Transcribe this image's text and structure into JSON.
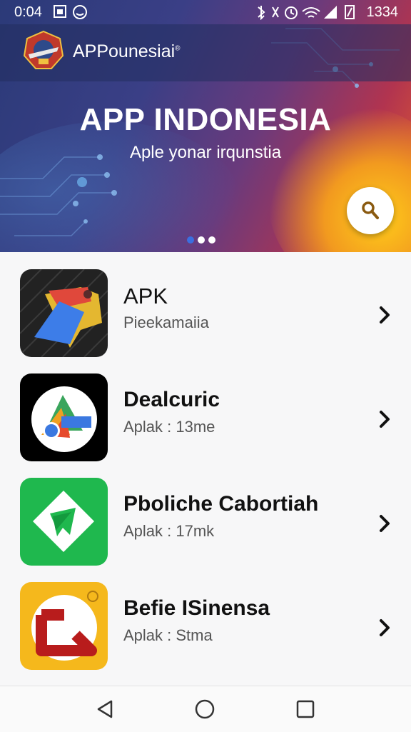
{
  "status_bar": {
    "time": "0:04",
    "battery": "1334",
    "left_icons": [
      "gallery-icon",
      "face-icon"
    ],
    "right_icons": [
      "bluetooth-icon",
      "vibrate-icon",
      "alarm-icon",
      "wifi-icon",
      "signal-icon",
      "battery-icon"
    ]
  },
  "app_bar": {
    "app_name": "APPounesiai",
    "trademark": "®"
  },
  "hero": {
    "title": "APP INDONESIA",
    "subtitle": "Aple yonar irqunstia",
    "slides": 3,
    "active_slide": 1
  },
  "apps": [
    {
      "name": "APK",
      "subtitle": "Pieekamaiia",
      "icon": "colored-tag-icon"
    },
    {
      "name": "Dealcuric",
      "subtitle": "Aplak : 13me",
      "icon": "google-shape-icon"
    },
    {
      "name": "Pboliche Cabortiah",
      "subtitle": "Aplak : 17mk",
      "icon": "green-diamond-icon"
    },
    {
      "name": "Befie ISinensa",
      "subtitle": "Aplak : Stma",
      "icon": "red-arrow-icon"
    }
  ],
  "colors": {
    "accent_blue": "#3b6fe0",
    "header_start": "#2b3a78",
    "header_end": "#e5602b",
    "search_icon": "#8a5a10"
  }
}
